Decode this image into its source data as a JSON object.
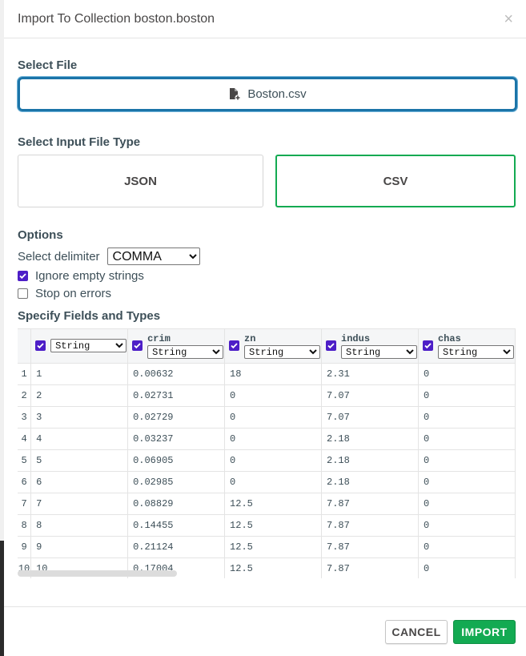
{
  "dialog": {
    "title": "Import To Collection boston.boston",
    "close_glyph": "×"
  },
  "select_file": {
    "label": "Select File",
    "file_name": "Boston.csv",
    "icon": "file-add-icon"
  },
  "file_type": {
    "label": "Select Input File Type",
    "options": [
      "JSON",
      "CSV"
    ],
    "selected": "CSV"
  },
  "options": {
    "label": "Options",
    "delimiter_label": "Select delimiter",
    "delimiter_value": "COMMA",
    "ignore_empty_label": "Ignore empty strings",
    "ignore_empty_checked": true,
    "stop_on_errors_label": "Stop on errors",
    "stop_on_errors_checked": false
  },
  "fields": {
    "label": "Specify Fields and Types",
    "columns": [
      {
        "name": "",
        "type": "String",
        "checked": true
      },
      {
        "name": "crim",
        "type": "String",
        "checked": true
      },
      {
        "name": "zn",
        "type": "String",
        "checked": true
      },
      {
        "name": "indus",
        "type": "String",
        "checked": true
      },
      {
        "name": "chas",
        "type": "String",
        "checked": true
      }
    ],
    "rows": [
      [
        "1",
        "1",
        "0.00632",
        "18",
        "2.31",
        "0"
      ],
      [
        "2",
        "2",
        "0.02731",
        "0",
        "7.07",
        "0"
      ],
      [
        "3",
        "3",
        "0.02729",
        "0",
        "7.07",
        "0"
      ],
      [
        "4",
        "4",
        "0.03237",
        "0",
        "2.18",
        "0"
      ],
      [
        "5",
        "5",
        "0.06905",
        "0",
        "2.18",
        "0"
      ],
      [
        "6",
        "6",
        "0.02985",
        "0",
        "2.18",
        "0"
      ],
      [
        "7",
        "7",
        "0.08829",
        "12.5",
        "7.87",
        "0"
      ],
      [
        "8",
        "8",
        "0.14455",
        "12.5",
        "7.87",
        "0"
      ],
      [
        "9",
        "9",
        "0.21124",
        "12.5",
        "7.87",
        "0"
      ],
      [
        "10",
        "10",
        "0.17004",
        "12.5",
        "7.87",
        "0"
      ]
    ]
  },
  "footer": {
    "cancel_label": "CANCEL",
    "import_label": "IMPORT"
  },
  "colors": {
    "accent_green": "#13aa52",
    "focus_blue": "#1b74a8",
    "checkbox_purple": "#4d1ec7"
  }
}
